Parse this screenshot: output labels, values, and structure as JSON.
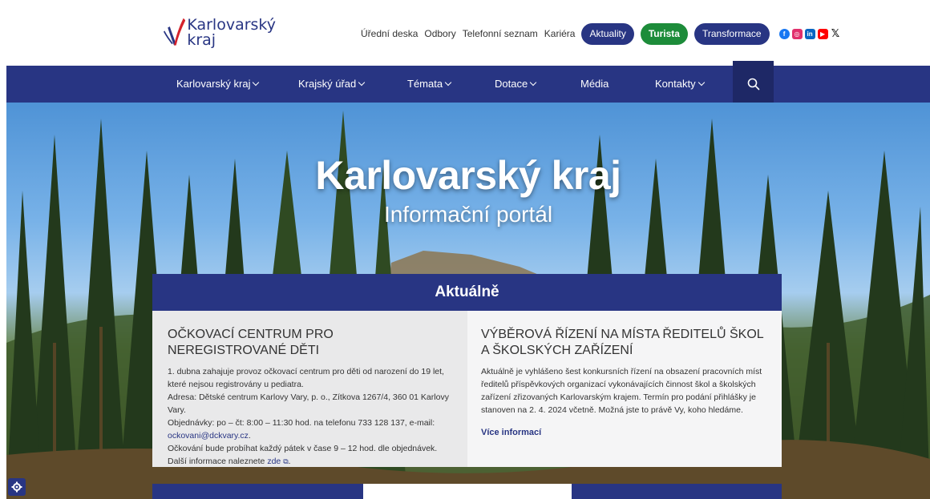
{
  "logo": {
    "name_line1": "Karlovarský",
    "name_line2": "kraj"
  },
  "toplinks": [
    "Úřední deska",
    "Odbory",
    "Telefonní seznam",
    "Kariéra"
  ],
  "pills": {
    "aktuality": "Aktuality",
    "turista": "Turista",
    "transformace": "Transformace"
  },
  "social_icons": [
    "facebook-icon",
    "instagram-icon",
    "linkedin-icon",
    "youtube-icon",
    "x-icon"
  ],
  "nav": {
    "items": [
      "Karlovarský kraj",
      "Krajský úřad",
      "Témata",
      "Dotace",
      "Média",
      "Kontakty"
    ],
    "search_icon": "search-icon"
  },
  "hero": {
    "title": "Karlovarský kraj",
    "subtitle": "Informační portál"
  },
  "aktualne": {
    "heading": "Aktuálně",
    "left": {
      "title": "OČKOVACÍ CENTRUM PRO NEREGISTROVANÉ DĚTI",
      "p1": "1. dubna zahajuje provoz očkovací centrum pro děti od narození do 19 let, které nejsou registrovány u pediatra.",
      "p2": "Adresa: Dětské centrum Karlovy Vary, p. o., Zítkova 1267/4, 360 01 Karlovy Vary.",
      "p3": "Objednávky: po – čt: 8:00 – 11:30 hod. na telefonu 733 128 137, e-mail:",
      "email": "ockovani@dckvary.cz",
      "email_after": ".",
      "p4": "Očkování bude probíhat každý pátek v čase 9 – 12 hod. dle objednávek.",
      "p5_before": "Další informace naleznete ",
      "p5_link": "zde",
      "p5_after": "."
    },
    "right": {
      "title": "VÝBĚROVÁ ŘÍZENÍ NA MÍSTA ŘEDITELŮ ŠKOL A ŠKOLSKÝCH ZAŘÍZENÍ",
      "text": "Aktuálně je vyhlášeno šest konkursních řízení na obsazení pracovních míst ředitelů příspěvkových organizací vykonávajících činnost škol a školských zařízení zřizovaných Karlovarským krajem. Termín pro podání přihlášky je stanoven na 2. 4. 2024 včetně. Možná jste to právě Vy, koho hledáme.",
      "more": "Více informací"
    }
  },
  "colors": {
    "brand_blue": "#283583",
    "green": "#1d8c3a"
  }
}
